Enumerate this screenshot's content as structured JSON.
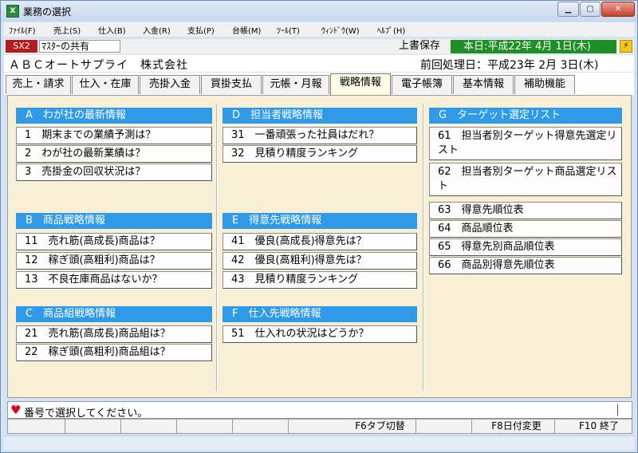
{
  "window": {
    "title": "業務の選択",
    "app_icon": "spreadsheet-icon"
  },
  "menu": [
    "ﾌｧｲﾙ(F)",
    "売上(S)",
    "仕入(B)",
    "入金(R)",
    "支払(P)",
    "台帳(M)",
    "ﾂｰﾙ(T)",
    "ｳｨﾝﾄﾞｳ(W)",
    "ﾍﾙﾌﾟ(H)"
  ],
  "toolbar": {
    "badge": "SX2",
    "master": "ﾏｽﾀｰの共有",
    "overwrite": "上書保存",
    "today": "本日:平成22年 4月 1日(木)"
  },
  "company": {
    "name": "ＡＢＣオートサプライ　株式会社",
    "previous": "前回処理日：平成23年 2月 3日(木)"
  },
  "tabs": [
    "売上・請求",
    "仕入・在庫",
    "売掛入金",
    "買掛支払",
    "元帳・月報",
    "戦略情報",
    "電子帳簿",
    "基本情報",
    "補助機能"
  ],
  "sections": {
    "a": {
      "title": "A　わが社の最新情報",
      "items": [
        "1　期末までの業績予測は？",
        "2　わが社の最新業績は？",
        "3　売掛金の回収状況は？"
      ]
    },
    "b": {
      "title": "B　商品戦略情報",
      "items": [
        "11　売れ筋(高成長)商品は？",
        "12　稼ぎ頭(高粗利)商品は？",
        "13　不良在庫商品はないか？"
      ]
    },
    "c": {
      "title": "C　商品組戦略情報",
      "items": [
        "21　売れ筋(高成長)商品組は？",
        "22　稼ぎ頭(高粗利)商品組は？"
      ]
    },
    "d": {
      "title": "D　担当者戦略情報",
      "items": [
        "31　一番頑張った社員はだれ？",
        "32　見積り精度ランキング"
      ]
    },
    "e": {
      "title": "E　得意先戦略情報",
      "items": [
        "41　優良(高成長)得意先は？",
        "42　優良(高粗利)得意先は？",
        "43　見積り精度ランキング"
      ]
    },
    "f": {
      "title": "F　仕入先戦略情報",
      "items": [
        "51　仕入れの状況はどうか？"
      ]
    },
    "g": {
      "title": "G　ターゲット選定リスト",
      "items": [
        "61　担当者別ターゲット得意先選定リスト",
        "62　担当者別ターゲット商品選定リスト",
        "63　得意先順位表",
        "64　商品順位表",
        "65　得意先別商品順位表",
        "66　商品別得意先順位表"
      ]
    }
  },
  "status": {
    "message": "番号で選択してください。"
  },
  "fkeys": {
    "f6": "F6タブ切替",
    "f8": "F8日付変更",
    "f10": "F10 終了"
  }
}
